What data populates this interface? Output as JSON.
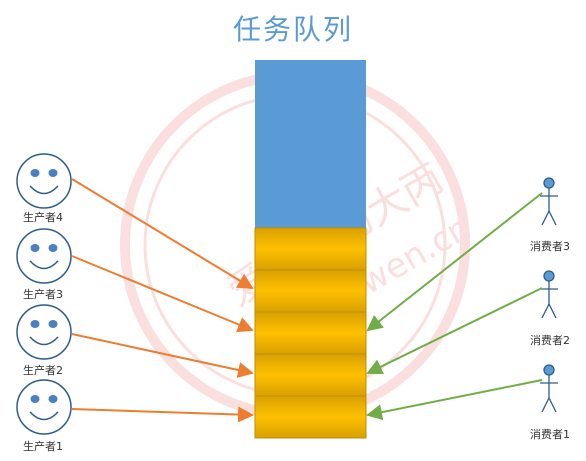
{
  "title": "任务队列",
  "watermark": {
    "cn": "爱编程的大丙",
    "en": "subingwen.cn"
  },
  "producers": [
    {
      "label": "生产者4"
    },
    {
      "label": "生产者3"
    },
    {
      "label": "生产者2"
    },
    {
      "label": "生产者1"
    }
  ],
  "consumers": [
    {
      "label": "消费者3"
    },
    {
      "label": "消费者2"
    },
    {
      "label": "消费者1"
    }
  ],
  "colors": {
    "queue_empty": "#5b9bd5",
    "queue_task": "#e6ac00",
    "producer_arrow": "#ed7d31",
    "consumer_arrow": "#70ad47",
    "title": "#5b9bd5",
    "watermark": "#f4c7c7"
  }
}
